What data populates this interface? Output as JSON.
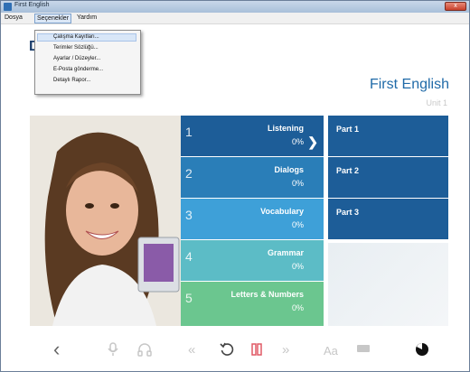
{
  "window": {
    "title": "First English",
    "close": "x"
  },
  "menubar": {
    "items": [
      "Dosya",
      "Seçenekler",
      "Yardım"
    ]
  },
  "dropdown": {
    "items": [
      "Çalışma Kayıtları...",
      "Terimler Sözlüğü...",
      "Ayarlar / Düzeyler...",
      "E-Posta gönderme...",
      "Detaylı Rapor..."
    ]
  },
  "header": {
    "partial_letter": "D",
    "title": "First English",
    "subtitle": "Unit 1"
  },
  "modules": [
    {
      "number": "1",
      "name": "Listening",
      "progress": "0%",
      "color": "#1d5d98",
      "arrow": "❯"
    },
    {
      "number": "2",
      "name": "Dialogs",
      "progress": "0%",
      "color": "#2a7eb8"
    },
    {
      "number": "3",
      "name": "Vocabulary",
      "progress": "0%",
      "color": "#3ea0d8"
    },
    {
      "number": "4",
      "name": "Grammar",
      "progress": "0%",
      "color": "#5cbcc6"
    },
    {
      "number": "5",
      "name": "Letters & Numbers",
      "progress": "0%",
      "color": "#6bc68f"
    }
  ],
  "parts": [
    "Part 1",
    "Part 2",
    "Part 3"
  ],
  "toolbar": {
    "back": "‹",
    "rewind": "«",
    "forward": "»",
    "font_size": "Aa"
  }
}
